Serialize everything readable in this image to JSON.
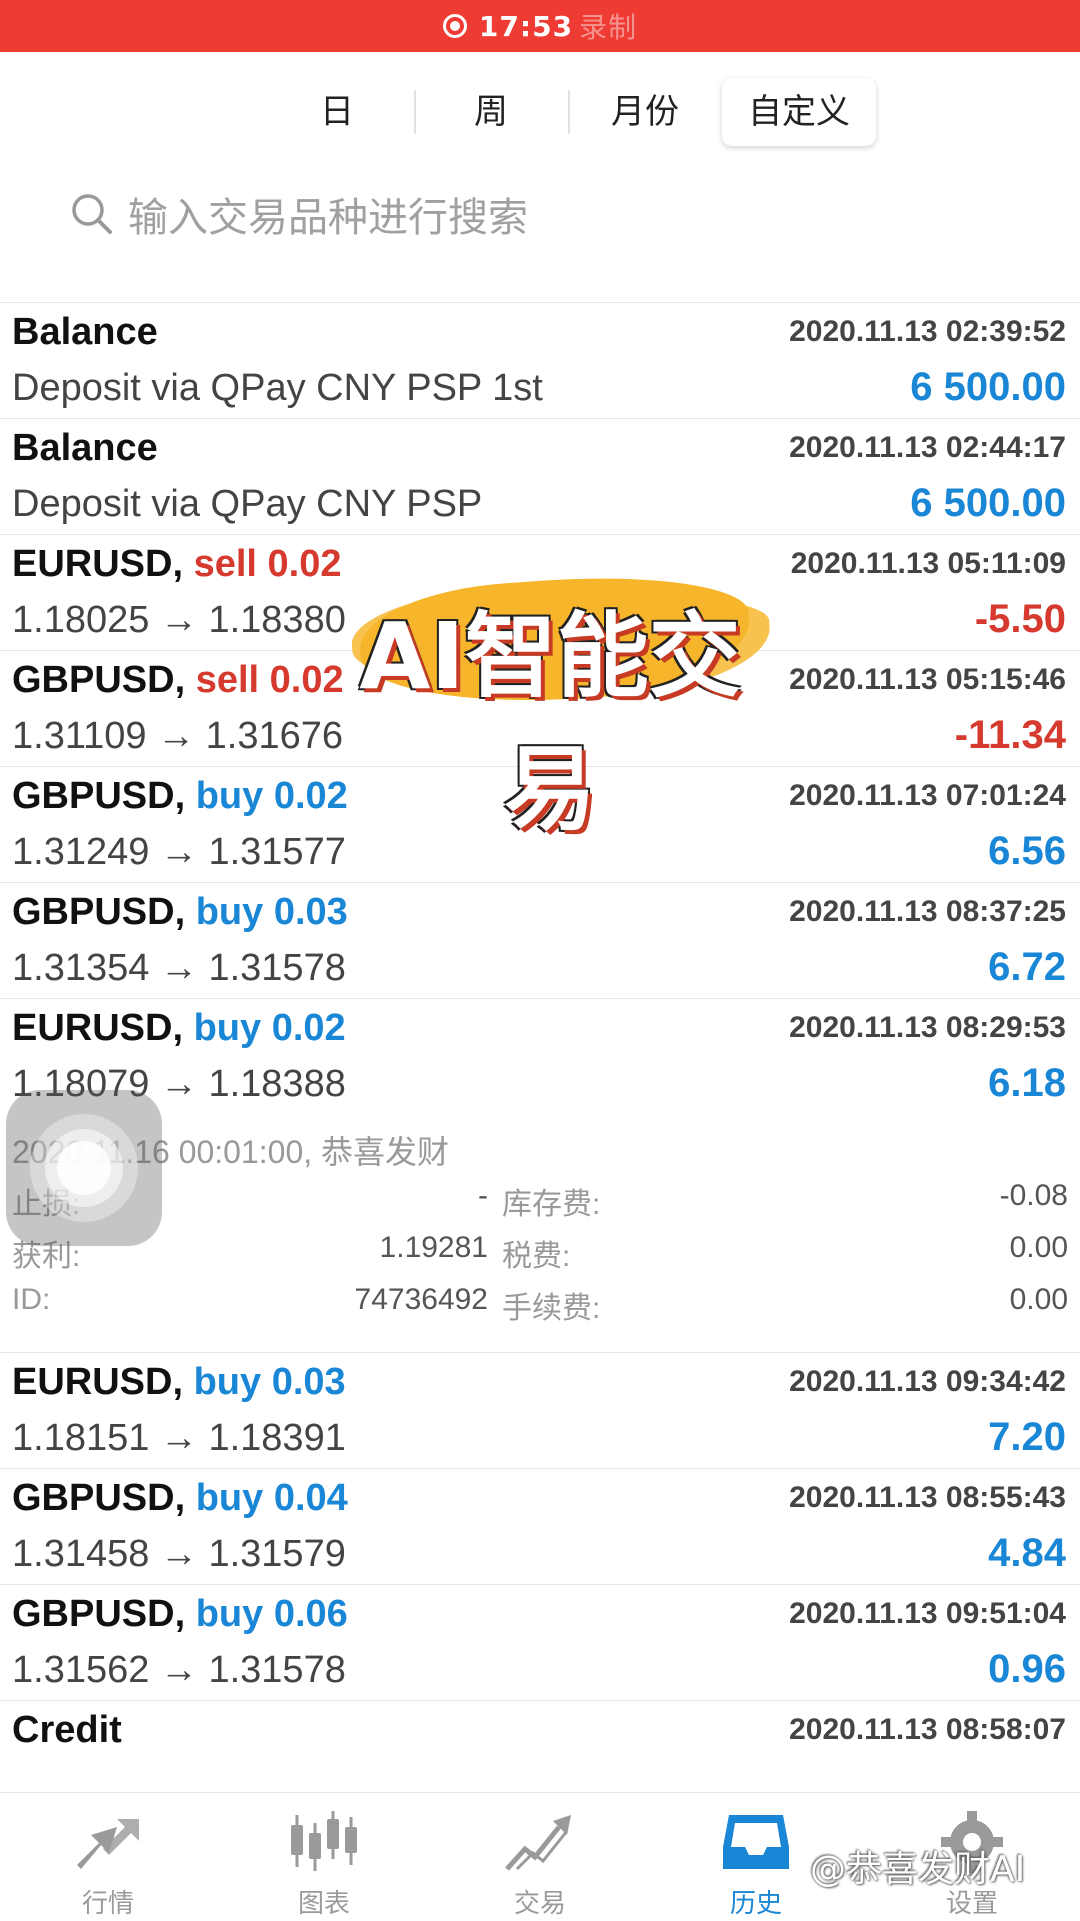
{
  "status_bar": {
    "time": "17:53",
    "recording_text": "录制"
  },
  "tabs": [
    {
      "label": "日",
      "active": false
    },
    {
      "label": "周",
      "active": false
    },
    {
      "label": "月份",
      "active": false
    },
    {
      "label": "自定义",
      "active": true
    }
  ],
  "search": {
    "placeholder": "输入交易品种进行搜索",
    "icon": "search-icon"
  },
  "rows": [
    {
      "title": "Balance",
      "side": "",
      "lot": "",
      "detail": "Deposit via QPay CNY PSP 1st",
      "time": "2020.11.13 02:39:52",
      "amount": "6 500.00",
      "sign": "pos"
    },
    {
      "title": "Balance",
      "side": "",
      "lot": "",
      "detail": "Deposit via QPay CNY PSP",
      "time": "2020.11.13 02:44:17",
      "amount": "6 500.00",
      "sign": "pos"
    },
    {
      "title": "EURUSD,",
      "side": "sell",
      "lot": "0.02",
      "detail": "1.18025 → 1.18380",
      "time": "2020.11.13 05:11:09",
      "amount": "-5.50",
      "sign": "neg"
    },
    {
      "title": "GBPUSD,",
      "side": "sell",
      "lot": "0.02",
      "detail": "1.31109 → 1.31676",
      "time": "2020.11.13 05:15:46",
      "amount": "-11.34",
      "sign": "neg"
    },
    {
      "title": "GBPUSD,",
      "side": "buy",
      "lot": "0.02",
      "detail": "1.31249 → 1.31577",
      "time": "2020.11.13 07:01:24",
      "amount": "6.56",
      "sign": "pos"
    },
    {
      "title": "GBPUSD,",
      "side": "buy",
      "lot": "0.03",
      "detail": "1.31354 → 1.31578",
      "time": "2020.11.13 08:37:25",
      "amount": "6.72",
      "sign": "pos"
    }
  ],
  "expanded_row": {
    "title": "EURUSD,",
    "side": "buy",
    "lot": "0.02",
    "detail": "1.18079 → 1.18388",
    "time": "2020.11.13 08:29:53",
    "amount": "6.18",
    "meta": "2020.11.16 00:01:00, 恭喜发财",
    "stop_loss_label": "止损:",
    "stop_loss": "-",
    "swap_label": "库存费:",
    "swap": "-0.08",
    "take_profit_label": "获利:",
    "take_profit": "1.19281",
    "tax_label": "税费:",
    "tax": "0.00",
    "id_label": "ID:",
    "id": "74736492",
    "commission_label": "手续费:",
    "commission": "0.00"
  },
  "rows_after": [
    {
      "title": "EURUSD,",
      "side": "buy",
      "lot": "0.03",
      "detail": "1.18151 → 1.18391",
      "time": "2020.11.13 09:34:42",
      "amount": "7.20",
      "sign": "pos"
    },
    {
      "title": "GBPUSD,",
      "side": "buy",
      "lot": "0.04",
      "detail": "1.31458 → 1.31579",
      "time": "2020.11.13 08:55:43",
      "amount": "4.84",
      "sign": "pos"
    },
    {
      "title": "GBPUSD,",
      "side": "buy",
      "lot": "0.06",
      "detail": "1.31562 → 1.31578",
      "time": "2020.11.13 09:51:04",
      "amount": "0.96",
      "sign": "pos"
    },
    {
      "title": "Credit",
      "side": "",
      "lot": "",
      "detail": "",
      "time": "2020.11.13 08:58:07",
      "amount": "",
      "sign": "pos"
    }
  ],
  "overlay_banner": "AI智能交易",
  "bottom_nav": [
    {
      "label": "行情",
      "icon": "quotes-icon",
      "active": false
    },
    {
      "label": "图表",
      "icon": "chart-icon",
      "active": false
    },
    {
      "label": "交易",
      "icon": "trade-icon",
      "active": false
    },
    {
      "label": "历史",
      "icon": "history-icon",
      "active": true
    },
    {
      "label": "设置",
      "icon": "settings-icon",
      "active": false
    }
  ],
  "watermark": "@恭喜发财AI",
  "colors": {
    "status_bar": "#ee3b33",
    "sell": "#d63a2e",
    "buy": "#1a86d6",
    "nav_active": "#1a86d6"
  }
}
